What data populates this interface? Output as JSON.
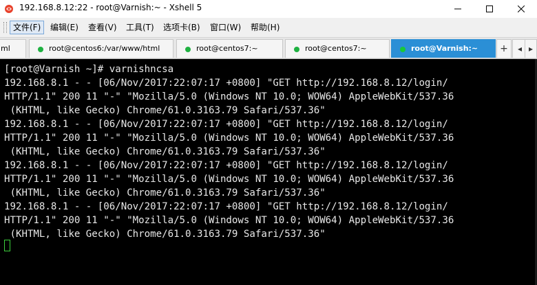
{
  "window": {
    "title": "192.168.8.12:22 - root@Varnish:~ - Xshell 5",
    "app_icon": "xshell-icon",
    "controls": [
      "minimize-icon",
      "maximize-icon",
      "close-icon"
    ]
  },
  "menu": {
    "items": [
      {
        "label": "文件(F)"
      },
      {
        "label": "编辑(E)"
      },
      {
        "label": "查看(V)"
      },
      {
        "label": "工具(T)"
      },
      {
        "label": "选项卡(B)"
      },
      {
        "label": "窗口(W)"
      },
      {
        "label": "帮助(H)"
      }
    ]
  },
  "tabs": {
    "items": [
      {
        "label": "ml"
      },
      {
        "label": "root@centos6:/var/www/html"
      },
      {
        "label": "root@centos7:~"
      },
      {
        "label": "root@centos7:~"
      },
      {
        "label": "root@Varnish:~"
      }
    ],
    "add_label": "+",
    "prev_label": "◂",
    "next_label": "▸",
    "status_color": "#1fb141",
    "active_color": "#2b8fd6"
  },
  "terminal": {
    "lines": [
      "[root@Varnish ~]# varnishncsa",
      "192.168.8.1 - - [06/Nov/2017:22:07:17 +0800] \"GET http://192.168.8.12/login/",
      "HTTP/1.1\" 200 11 \"-\" \"Mozilla/5.0 (Windows NT 10.0; WOW64) AppleWebKit/537.36",
      " (KHTML, like Gecko) Chrome/61.0.3163.79 Safari/537.36\"",
      "192.168.8.1 - - [06/Nov/2017:22:07:17 +0800] \"GET http://192.168.8.12/login/",
      "HTTP/1.1\" 200 11 \"-\" \"Mozilla/5.0 (Windows NT 10.0; WOW64) AppleWebKit/537.36",
      " (KHTML, like Gecko) Chrome/61.0.3163.79 Safari/537.36\"",
      "192.168.8.1 - - [06/Nov/2017:22:07:17 +0800] \"GET http://192.168.8.12/login/",
      "HTTP/1.1\" 200 11 \"-\" \"Mozilla/5.0 (Windows NT 10.0; WOW64) AppleWebKit/537.36",
      " (KHTML, like Gecko) Chrome/61.0.3163.79 Safari/537.36\"",
      "192.168.8.1 - - [06/Nov/2017:22:07:17 +0800] \"GET http://192.168.8.12/login/",
      "HTTP/1.1\" 200 11 \"-\" \"Mozilla/5.0 (Windows NT 10.0; WOW64) AppleWebKit/537.36",
      " (KHTML, like Gecko) Chrome/61.0.3163.79 Safari/537.36\""
    ],
    "cursor_color": "#3ccf3c"
  }
}
